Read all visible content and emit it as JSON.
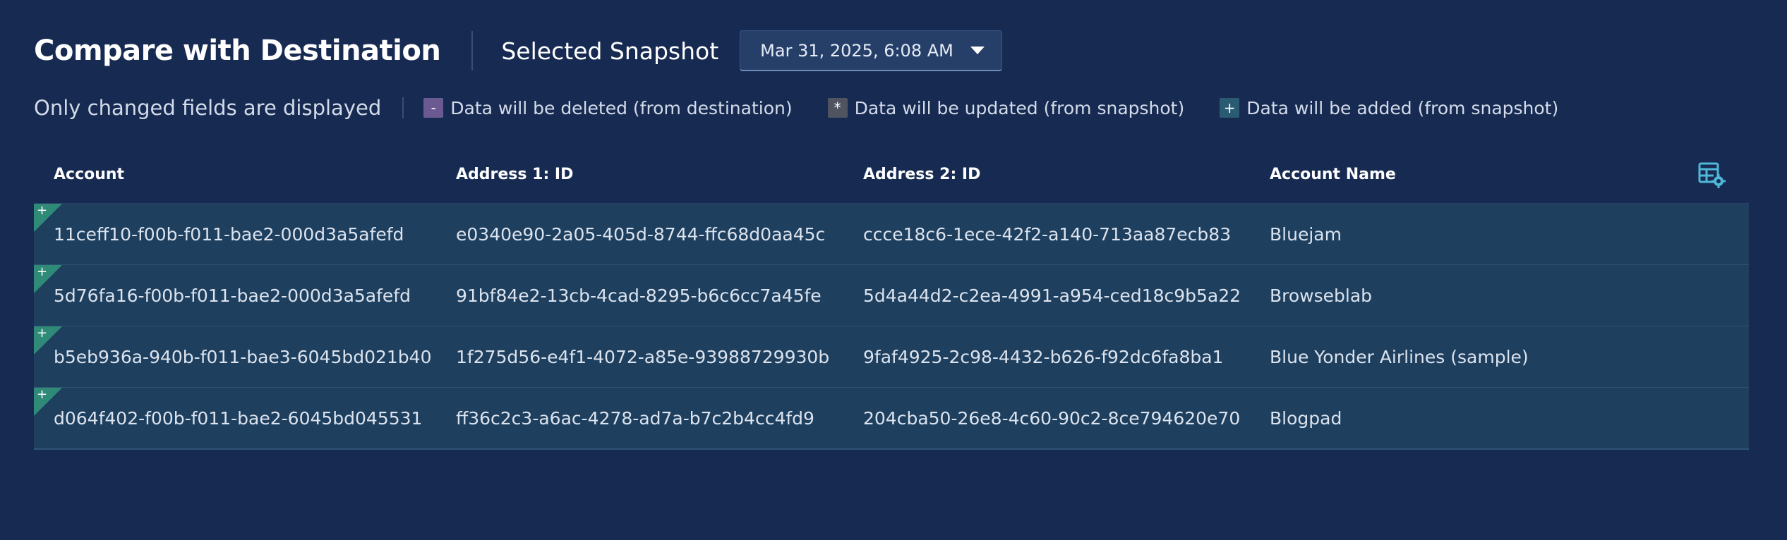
{
  "header": {
    "title": "Compare with Destination",
    "snapshot_label": "Selected Snapshot",
    "snapshot_value": "Mar 31, 2025, 6:08 AM"
  },
  "legend": {
    "note": "Only changed fields are displayed",
    "items": [
      {
        "symbol": "-",
        "text": "Data will be deleted (from destination)"
      },
      {
        "symbol": "*",
        "text": "Data will be updated (from snapshot)"
      },
      {
        "symbol": "+",
        "text": "Data will be added (from snapshot)"
      }
    ]
  },
  "table": {
    "columns": [
      "Account",
      "Address 1: ID",
      "Address 2: ID",
      "Account Name"
    ],
    "rows": [
      {
        "marker": "+",
        "cells": [
          "11ceff10-f00b-f011-bae2-000d3a5afefd",
          "e0340e90-2a05-405d-8744-ffc68d0aa45c",
          "ccce18c6-1ece-42f2-a140-713aa87ecb83",
          "Bluejam"
        ]
      },
      {
        "marker": "+",
        "cells": [
          "5d76fa16-f00b-f011-bae2-000d3a5afefd",
          "91bf84e2-13cb-4cad-8295-b6c6cc7a45fe",
          "5d4a44d2-c2ea-4991-a954-ced18c9b5a22",
          "Browseblab"
        ]
      },
      {
        "marker": "+",
        "cells": [
          "b5eb936a-940b-f011-bae3-6045bd021b40",
          "1f275d56-e4f1-4072-a85e-93988729930b",
          "9faf4925-2c98-4432-b626-f92dc6fa8ba1",
          "Blue Yonder Airlines (sample)"
        ]
      },
      {
        "marker": "+",
        "cells": [
          "d064f402-f00b-f011-bae2-6045bd045531",
          "ff36c2c3-a6ac-4278-ad7a-b7c2b4cc4fd9",
          "204cba50-26e8-4c60-90c2-8ce794620e70",
          "Blogpad"
        ]
      }
    ]
  },
  "colors": {
    "background": "#172b52",
    "row_background": "#1e3f5e",
    "added_marker": "#2f8a78",
    "deleted_box": "#6a5a91",
    "updated_box": "#505460",
    "added_box": "#2b5a73",
    "settings_icon": "#4fb8d8"
  },
  "icons": {
    "dropdown": "chevron-down-icon",
    "settings": "table-settings-icon",
    "row_marker": "added-row-marker-icon"
  }
}
